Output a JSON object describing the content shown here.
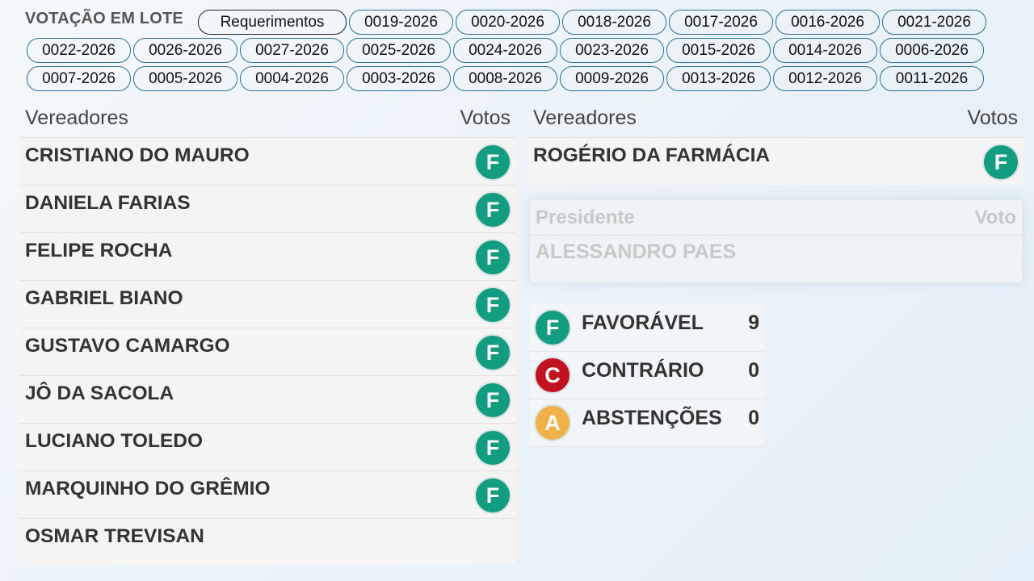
{
  "header": {
    "lote_label": "VOTAÇÃO EM LOTE",
    "chips": [
      {
        "label": "Requerimentos",
        "active": true
      },
      {
        "label": "0019-2026"
      },
      {
        "label": "0020-2026"
      },
      {
        "label": "0018-2026"
      },
      {
        "label": "0017-2026"
      },
      {
        "label": "0016-2026"
      },
      {
        "label": "0021-2026"
      },
      {
        "label": "0022-2026"
      },
      {
        "label": "0026-2026"
      },
      {
        "label": "0027-2026"
      },
      {
        "label": "0025-2026"
      },
      {
        "label": "0024-2026"
      },
      {
        "label": "0023-2026"
      },
      {
        "label": "0015-2026"
      },
      {
        "label": "0014-2026"
      },
      {
        "label": "0006-2026"
      },
      {
        "label": "0007-2026"
      },
      {
        "label": "0005-2026"
      },
      {
        "label": "0004-2026"
      },
      {
        "label": "0003-2026"
      },
      {
        "label": "0008-2026"
      },
      {
        "label": "0009-2026"
      },
      {
        "label": "0013-2026"
      },
      {
        "label": "0012-2026"
      },
      {
        "label": "0011-2026"
      }
    ]
  },
  "left_table": {
    "col_name": "Vereadores",
    "col_votes": "Votos",
    "rows": [
      {
        "name": "CRISTIANO DO MAURO",
        "vote": "F"
      },
      {
        "name": "DANIELA FARIAS",
        "vote": "F"
      },
      {
        "name": "FELIPE ROCHA",
        "vote": "F"
      },
      {
        "name": "GABRIEL BIANO",
        "vote": "F"
      },
      {
        "name": "GUSTAVO CAMARGO",
        "vote": "F"
      },
      {
        "name": "JÔ DA SACOLA",
        "vote": "F"
      },
      {
        "name": "LUCIANO TOLEDO",
        "vote": "F"
      },
      {
        "name": "MARQUINHO DO GRÊMIO",
        "vote": "F"
      },
      {
        "name": "OSMAR TREVISAN",
        "vote": ""
      }
    ]
  },
  "right_table": {
    "col_name": "Vereadores",
    "col_votes": "Votos",
    "rows": [
      {
        "name": "ROGÉRIO DA FARMÁCIA",
        "vote": "F"
      }
    ]
  },
  "president": {
    "col_name": "Presidente",
    "col_vote": "Voto",
    "name": "ALESSANDRO PAES"
  },
  "summary": [
    {
      "icon": "F",
      "label": "FAVORÁVEL",
      "count": "9"
    },
    {
      "icon": "C",
      "label": "CONTRÁRIO",
      "count": "0"
    },
    {
      "icon": "A",
      "label": "ABSTENÇÕES",
      "count": "0"
    }
  ],
  "colors": {
    "favoravel": "#129c80",
    "contrario": "#c1121f",
    "abstencao": "#f0b04a",
    "chip_border": "#2e6e98"
  }
}
